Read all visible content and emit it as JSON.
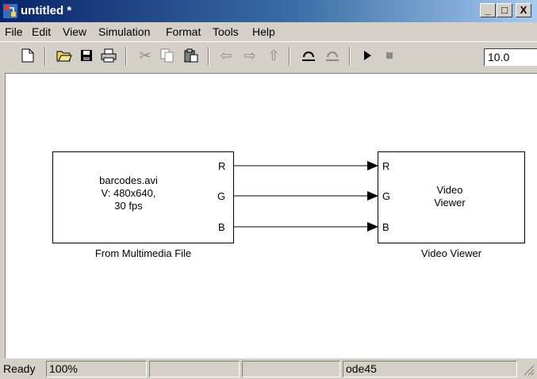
{
  "window": {
    "title": "untitled *",
    "minimize": "_",
    "maximize": "□",
    "close": "X"
  },
  "menu": [
    "File",
    "Edit",
    "View",
    "Simulation",
    "Format",
    "Tools",
    "Help"
  ],
  "toolbar": {
    "stop_time": "10.0"
  },
  "blocks": {
    "source": {
      "lines": [
        "barcodes.avi",
        "V: 480x640,",
        "30 fps"
      ],
      "ports": [
        "R",
        "G",
        "B"
      ],
      "label": "From Multimedia File"
    },
    "viewer": {
      "lines": [
        "Video",
        "Viewer"
      ],
      "ports": [
        "R",
        "G",
        "B"
      ],
      "label": "Video Viewer"
    }
  },
  "status": {
    "state": "Ready",
    "zoom": "100%",
    "solver": "ode45"
  }
}
